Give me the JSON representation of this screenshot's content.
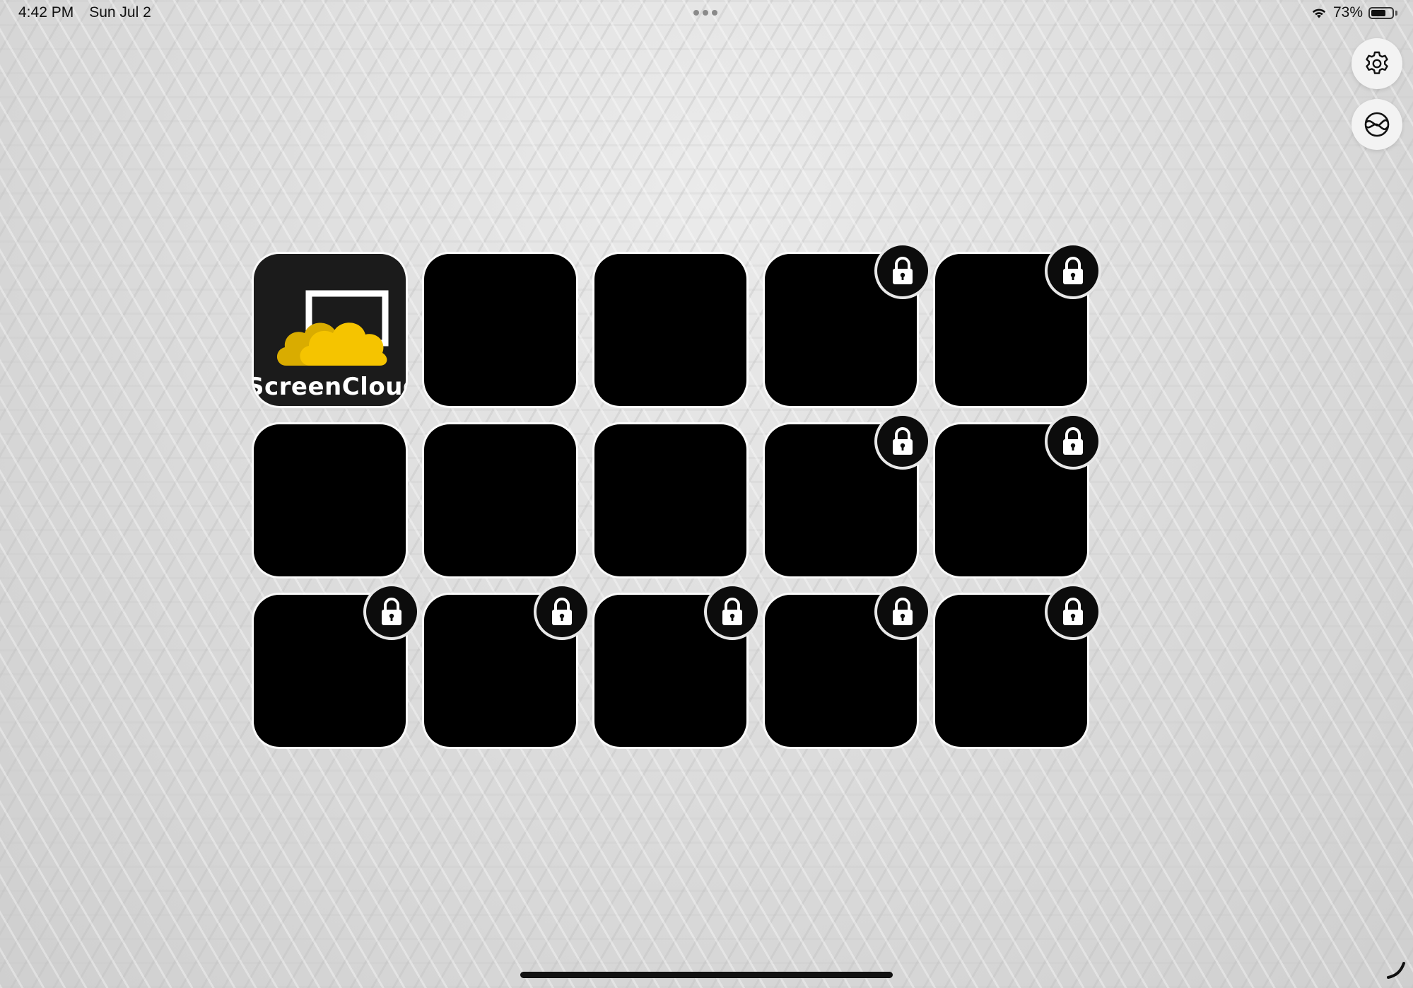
{
  "status_bar": {
    "time": "4:42 PM",
    "date": "Sun Jul 2",
    "battery_percent": "73%",
    "battery_level": 0.73,
    "icons": [
      "wifi-icon",
      "battery-icon",
      "multitasking-dots-icon"
    ]
  },
  "side_buttons": [
    {
      "icon": "gear-icon",
      "role": "settings"
    },
    {
      "icon": "sphere-icon",
      "role": "overview"
    }
  ],
  "grid": {
    "app_tile": {
      "name": "ScreenCloud",
      "logo": "screencloud-logo",
      "locked": false
    },
    "tiles": [
      {
        "locked": false
      },
      {
        "locked": false
      },
      {
        "locked": true
      },
      {
        "locked": true
      },
      {
        "locked": false
      },
      {
        "locked": false
      },
      {
        "locked": false
      },
      {
        "locked": true
      },
      {
        "locked": true
      },
      {
        "locked": true
      },
      {
        "locked": true
      },
      {
        "locked": true
      },
      {
        "locked": true
      },
      {
        "locked": true
      }
    ],
    "lock_icon": "lock-icon"
  },
  "colors": {
    "tile": "#000000",
    "logo_yellow": "#f5c400",
    "logo_yellow_dark": "#d9ac00",
    "badge": "#0c0c0c"
  }
}
